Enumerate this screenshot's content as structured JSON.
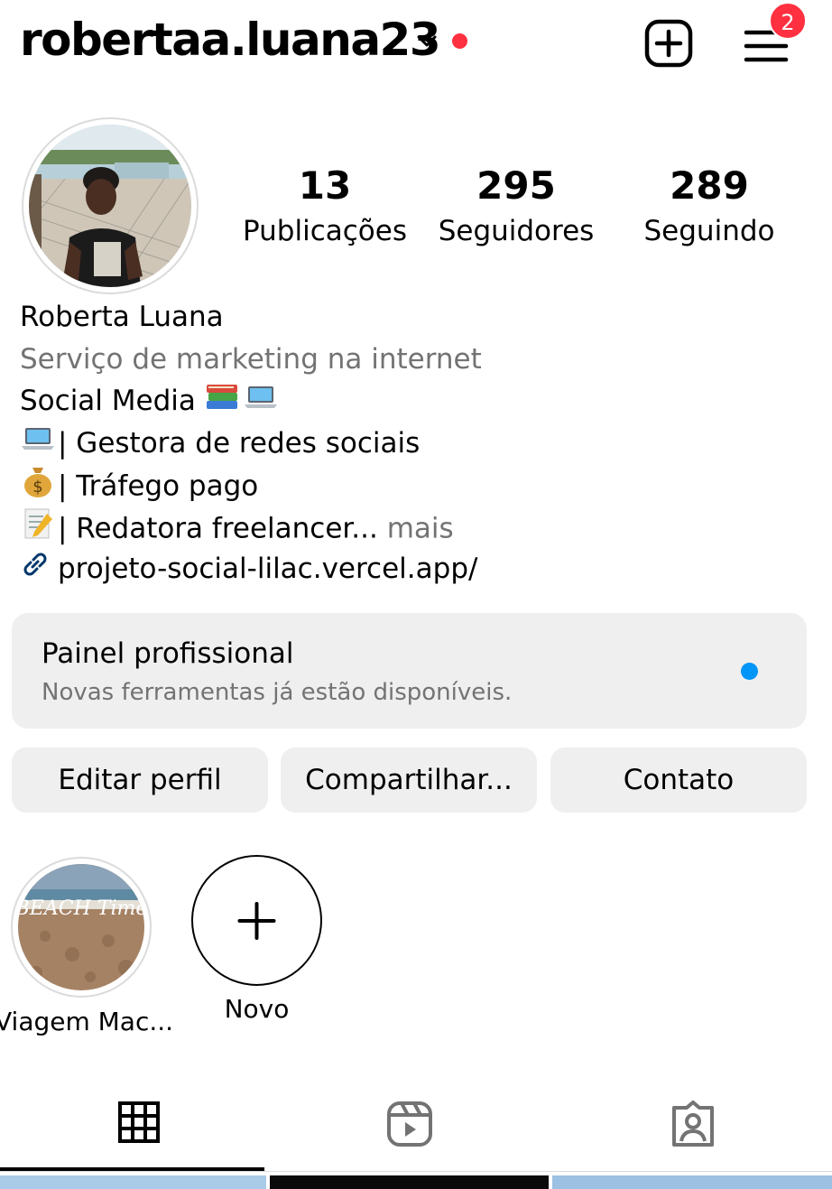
{
  "header": {
    "username": "robertaa.luana23",
    "notification_count": "2",
    "badge_color": "#ff3040"
  },
  "profile": {
    "stats": [
      {
        "value": "13",
        "label": "Publicações"
      },
      {
        "value": "295",
        "label": "Seguidores"
      },
      {
        "value": "289",
        "label": "Seguindo"
      }
    ],
    "name": "Roberta Luana",
    "category": "Serviço de marketing na internet",
    "bio": {
      "line1": "Social Media",
      "line2": "| Gestora de redes sociais",
      "line3": "| Tráfego pago",
      "line4": "| Redatora freelancer...",
      "more": " mais"
    },
    "link": "projeto-social-lilac.vercel.app/",
    "link_color": "#00376b"
  },
  "dashboard": {
    "title": "Painel profissional",
    "subtitle": "Novas ferramentas já estão disponíveis.",
    "dot_color": "#0095f6"
  },
  "actions": {
    "edit": "Editar perfil",
    "share": "Compartilhar...",
    "contact": "Contato",
    "button_bg": "#efefef"
  },
  "highlights": {
    "items": [
      {
        "label": "Viagem Mac...",
        "image_text": "BEACH Time"
      }
    ],
    "new_label": "Novo"
  },
  "tabs": [
    {
      "icon": "grid-icon",
      "active": true
    },
    {
      "icon": "reels-icon",
      "active": false
    },
    {
      "icon": "tagged-icon",
      "active": false
    }
  ]
}
